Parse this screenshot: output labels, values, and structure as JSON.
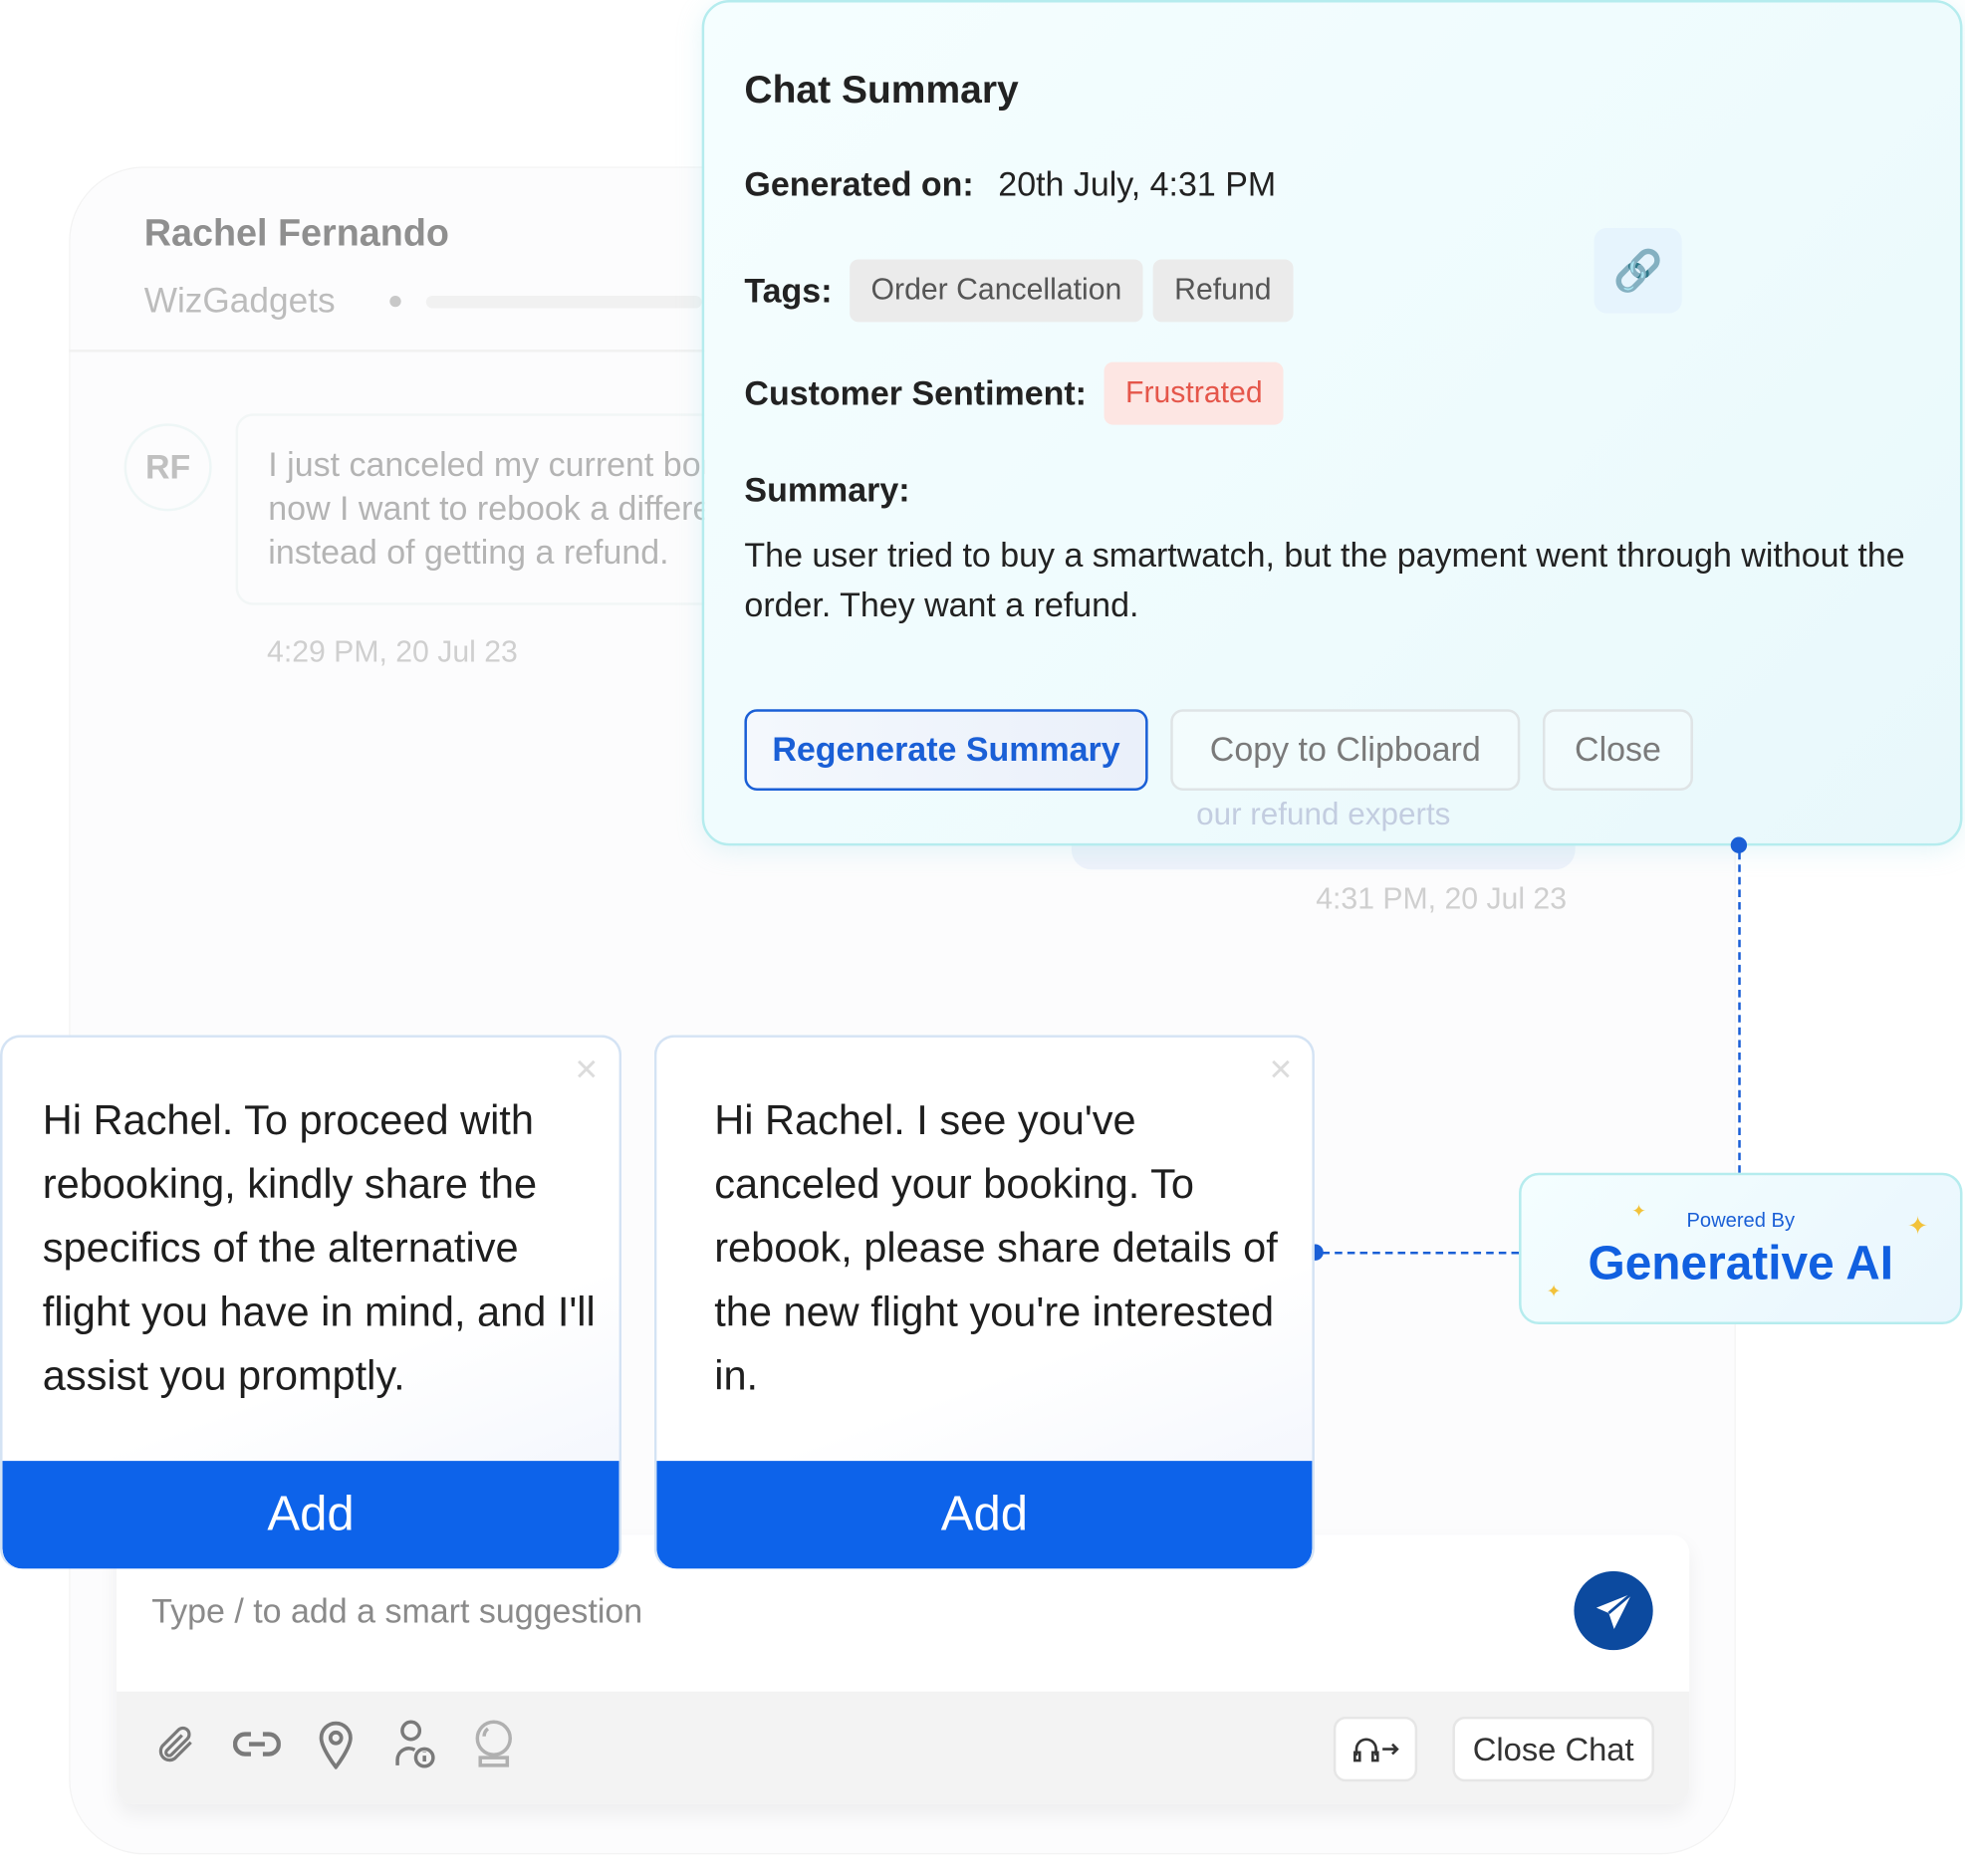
{
  "chat": {
    "contact_name": "Rachel Fernando",
    "company": "WizGadgets",
    "avatar_initials": "RF",
    "customer_message": "I just canceled my current booking, and now I want to rebook a different flight instead of getting a refund.",
    "customer_timestamp": "4:29 PM,  20 Jul 23",
    "agent_message_partial": "our refund experts",
    "agent_timestamp": "4:31 PM,  20 Jul 23"
  },
  "summary": {
    "title": "Chat Summary",
    "generated_label": "Generated on:",
    "generated_value": "20th July, 4:31 PM",
    "tags_label": "Tags:",
    "tags": [
      "Order Cancellation",
      "Refund"
    ],
    "sentiment_label": "Customer Sentiment:",
    "sentiment_value": "Frustrated",
    "summary_label": "Summary:",
    "summary_text": "The user tried to buy a smartwatch, but the payment went through without the order. They want a refund.",
    "buttons": {
      "regenerate": "Regenerate Summary",
      "copy": "Copy to Clipboard",
      "close": "Close"
    }
  },
  "badge": {
    "powered_by": "Powered By",
    "name": "Generative AI"
  },
  "suggestions": [
    {
      "text": "Hi Rachel. To proceed with rebooking, kindly share the specifics of the alternative flight you have in mind, and I'll assist you promptly.",
      "add_label": "Add"
    },
    {
      "text": "Hi Rachel. I see you've canceled your booking. To rebook, please share details of the new flight you're interested in.",
      "add_label": "Add"
    }
  ],
  "composer": {
    "placeholder": "Type / to add a smart suggestion",
    "close_chat_label": "Close Chat",
    "toolbar_icons": [
      "paperclip-icon",
      "link-icon",
      "location-pin-icon",
      "user-info-icon",
      "crystal-ball-icon"
    ]
  },
  "colors": {
    "accent": "#0d63ea",
    "send": "#0c4a9f",
    "sentiment": "#e5564a",
    "sparkle": "#f2c23a"
  }
}
